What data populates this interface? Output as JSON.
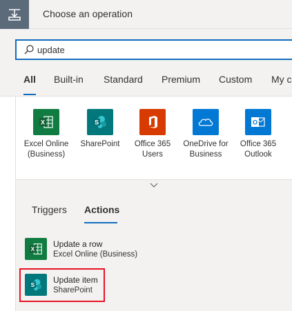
{
  "header": {
    "title": "Choose an operation"
  },
  "search": {
    "value": "update",
    "placeholder": ""
  },
  "tabs": [
    {
      "label": "All",
      "active": true
    },
    {
      "label": "Built-in",
      "active": false
    },
    {
      "label": "Standard",
      "active": false
    },
    {
      "label": "Premium",
      "active": false
    },
    {
      "label": "Custom",
      "active": false
    },
    {
      "label": "My c",
      "active": false
    }
  ],
  "connectors": [
    {
      "label": "Excel Online (Business)",
      "icon": "excel-icon",
      "color": "#107c41"
    },
    {
      "label": "SharePoint",
      "icon": "sharepoint-icon",
      "color": "#03787c"
    },
    {
      "label": "Office 365 Users",
      "icon": "office-icon",
      "color": "#d83b01"
    },
    {
      "label": "OneDrive for Business",
      "icon": "onedrive-icon",
      "color": "#0078d4"
    },
    {
      "label": "Office 365 Outlook",
      "icon": "outlook-icon",
      "color": "#0078d4"
    }
  ],
  "subtabs": [
    {
      "label": "Triggers",
      "active": false
    },
    {
      "label": "Actions",
      "active": true
    }
  ],
  "actions": [
    {
      "title": "Update a row",
      "connector": "Excel Online (Business)",
      "icon": "excel-icon",
      "color": "#107c41"
    },
    {
      "title": "Update item",
      "connector": "SharePoint",
      "icon": "sharepoint-icon",
      "color": "#03787c",
      "highlighted": true
    }
  ],
  "colors": {
    "accent": "#0f6cbd",
    "highlight": "#e81123",
    "header_icon_bg": "#5c6b7a"
  }
}
